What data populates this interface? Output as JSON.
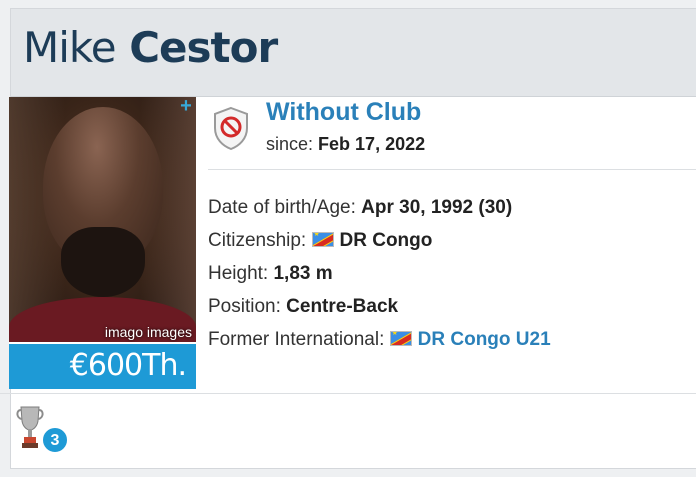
{
  "player": {
    "first_name": "Mike",
    "last_name": "Cestor",
    "photo_credit": "imago images",
    "market_value": "€600Th."
  },
  "club": {
    "name": "Without Club",
    "since_label": "since:",
    "since_date": "Feb 17, 2022",
    "badge_icon": "no-club-shield-icon"
  },
  "details": {
    "dob_label": "Date of birth/Age:",
    "dob_value": "Apr 30, 1992 (30)",
    "citizenship_label": "Citizenship:",
    "citizenship_value": "DR Congo",
    "height_label": "Height:",
    "height_value": "1,83 m",
    "position_label": "Position:",
    "position_value": "Centre-Back",
    "former_int_label": "Former International:",
    "former_int_value": "DR Congo U21"
  },
  "trophies": {
    "count": "3",
    "icon": "trophy-icon"
  },
  "colors": {
    "accent": "#1e9ad6",
    "link": "#2a80b9",
    "heading": "#1d3c57"
  }
}
